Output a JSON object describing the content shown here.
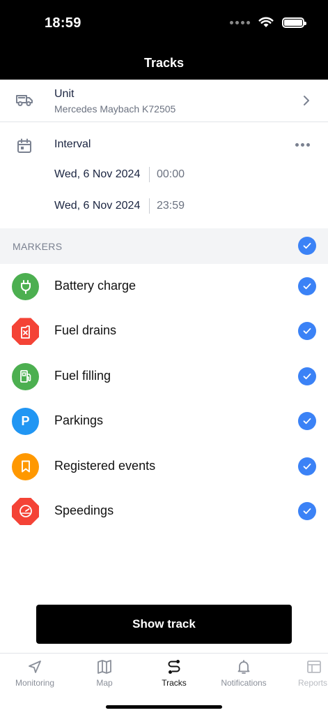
{
  "status_bar": {
    "time": "18:59"
  },
  "nav": {
    "title": "Tracks"
  },
  "unit": {
    "label": "Unit",
    "value": "Mercedes Maybach K72505"
  },
  "interval": {
    "label": "Interval",
    "from": {
      "date": "Wed, 6 Nov 2024",
      "time": "00:00"
    },
    "to": {
      "date": "Wed, 6 Nov 2024",
      "time": "23:59"
    }
  },
  "markers": {
    "title": "MARKERS",
    "all_checked": true,
    "items": [
      {
        "label": "Battery charge",
        "icon": "plug-icon",
        "color": "#4caf50",
        "shape": "circle",
        "checked": true
      },
      {
        "label": "Fuel drains",
        "icon": "fuel-drain-icon",
        "color": "#f44336",
        "shape": "octagon",
        "checked": true
      },
      {
        "label": "Fuel filling",
        "icon": "fuel-pump-icon",
        "color": "#4caf50",
        "shape": "circle",
        "checked": true
      },
      {
        "label": "Parkings",
        "icon": "parking-icon",
        "icon_text": "P",
        "color": "#2196f3",
        "shape": "circle",
        "checked": true
      },
      {
        "label": "Registered events",
        "icon": "bookmark-icon",
        "color": "#ff9800",
        "shape": "circle",
        "checked": true
      },
      {
        "label": "Speedings",
        "icon": "speedometer-icon",
        "color": "#f44336",
        "shape": "octagon",
        "checked": true
      }
    ]
  },
  "actions": {
    "show_track": "Show track"
  },
  "tabs": [
    {
      "label": "Monitoring",
      "icon": "navigation-arrow-icon",
      "active": false
    },
    {
      "label": "Map",
      "icon": "map-icon",
      "active": false
    },
    {
      "label": "Tracks",
      "icon": "route-icon",
      "active": true
    },
    {
      "label": "Notifications",
      "icon": "bell-icon",
      "active": false
    },
    {
      "label": "Reports",
      "icon": "report-table-icon",
      "active": false
    }
  ],
  "colors": {
    "accent": "#3b82f6",
    "header": "#000000"
  }
}
